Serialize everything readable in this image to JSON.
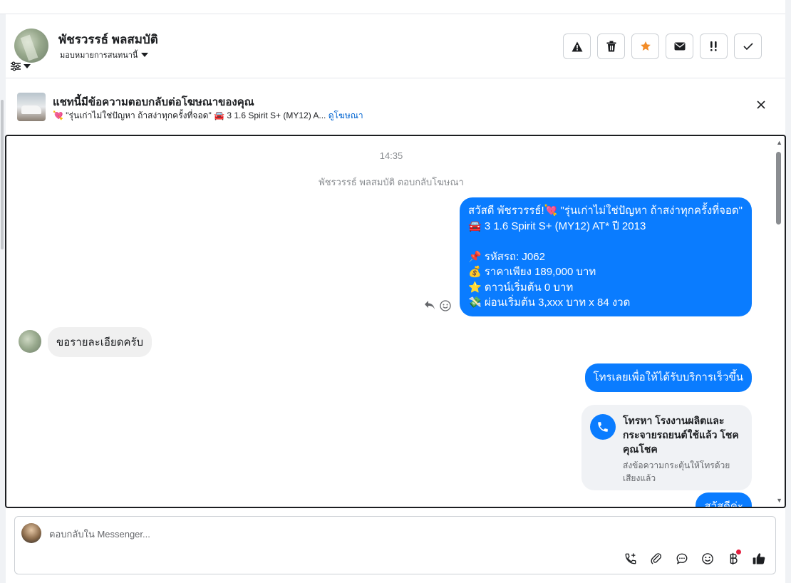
{
  "header": {
    "name": "พัชรวรรธ์ พลสมบัติ",
    "assign_label": "มอบหมายการสนทนานี้"
  },
  "actions": [
    {
      "name": "report-button",
      "icon": "warning-icon"
    },
    {
      "name": "delete-button",
      "icon": "trash-icon"
    },
    {
      "name": "star-button",
      "icon": "star-icon",
      "color": "#f28c28"
    },
    {
      "name": "mark-unread-button",
      "icon": "envelope-icon"
    },
    {
      "name": "follow-up-button",
      "icon": "exclamation-icon"
    },
    {
      "name": "mark-done-button",
      "icon": "check-icon"
    }
  ],
  "ad_banner": {
    "title": "แชทนี้มีข้อความตอบกลับต่อโฆษณาของคุณ",
    "snippet": "\"รุ่นเก่าไม่ใช่ปัญหา ถ้าสง่าทุกครั้งที่จอด\" 🚘 3 1.6 Spirit S+ (MY12) A...",
    "snippet_prefix": "💘",
    "link": "ดูโฆษณา"
  },
  "thread": {
    "time": "14:35",
    "system_message": "พัชรวรรธ์ พลสมบัติ ตอบกลับโฆษณา",
    "message_ad_reply": {
      "line1": "สวัสดี พัชรวรรธ์!💘 \"รุ่นเก่าไม่ใช่ปัญหา ถ้าสง่าทุกครั้งที่จอด\"",
      "line2": "🚘 3 1.6 Spirit S+ (MY12) AT*  ปี 2013",
      "line3": "📌 รหัสรถ: J062",
      "line4": "💰 ราคาเพียง 189,000 บาท",
      "line5": "⭐ ดาวน์เริ่มต้น 0 บาท",
      "line6": "💸 ผ่อนเริ่มต้น 3,xxx บาท x 84 งวด"
    },
    "incoming_message": "ขอรายละเอียดครับ",
    "outgoing_call_prompt": "โทรเลยเพื่อให้ได้รับบริการเร็วขึ้น",
    "call_card": {
      "title": "โทรหา โรงงานผลิตและกระจายรถยนต์ใช้แล้ว โชคคุณโชค",
      "subtitle": "ส่งข้อความกระตุ้นให้โทรด้วยเสียงแล้ว"
    },
    "partial_message": "สวัสดีค่ะ"
  },
  "composer": {
    "placeholder": "ตอบกลับใน Messenger..."
  },
  "colors": {
    "accent": "#0a7cff",
    "link": "#0064d1"
  }
}
